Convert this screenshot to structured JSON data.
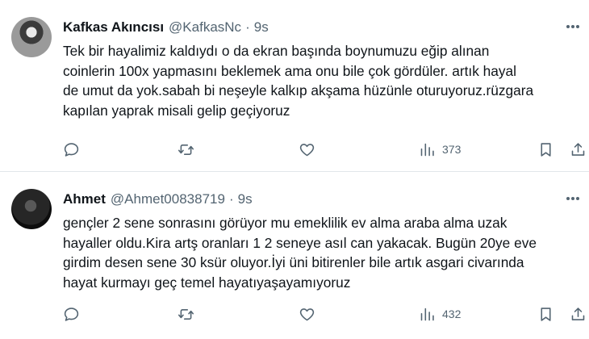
{
  "tweets": [
    {
      "name": "Kafkas Akıncısı",
      "handle": "@KafkasNc",
      "separator": "·",
      "time": "9s",
      "text": "Tek bir hayalimiz kaldıydı o da ekran başında boynumuzu eğip alınan\ncoinlerin 100x yapmasını beklemek ama onu bile çok gördüler. artık hayal\nde umut da yok.sabah bi neşeyle kalkıp akşama hüzünle oturuyoruz.rüzgara\nkapılan yaprak misali gelip geçiyoruz",
      "views": "373"
    },
    {
      "name": "Ahmet",
      "handle": "@Ahmet00838719",
      "separator": "·",
      "time": "9s",
      "text": "gençler 2 sene sonrasını görüyor mu emeklilik ev alma araba alma uzak\nhayaller oldu.Kira artş oranları 1 2 seneye asıl can yakacak. Bugün 20ye eve\ngirdim desen sene 30 ksür oluyor.İyi üni bitirenler bile artık asgari civarında\nhayat kurmayı geç temel hayatıyaşayamıyoruz",
      "views": "432"
    }
  ],
  "icons": {
    "reply": "reply-icon",
    "retweet": "retweet-icon",
    "like": "heart-icon",
    "views": "views-icon",
    "bookmark": "bookmark-icon",
    "share": "share-icon",
    "more": "more-dots-icon"
  },
  "colors": {
    "text": "#0f1419",
    "secondary": "#536471",
    "divider": "#e1e6ea"
  }
}
